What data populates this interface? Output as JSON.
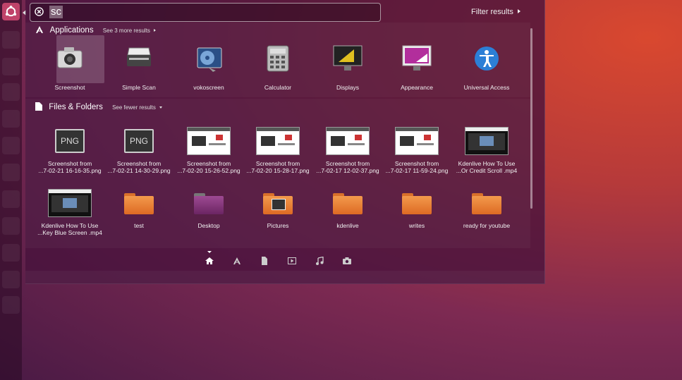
{
  "search": {
    "query": "sc"
  },
  "filter": {
    "label": "Filter results"
  },
  "applications": {
    "title": "Applications",
    "more": "See 3 more results",
    "items": [
      {
        "label": "Screenshot",
        "icon": "camera-icon"
      },
      {
        "label": "Simple Scan",
        "icon": "scanner-icon"
      },
      {
        "label": "vokoscreen",
        "icon": "film-reel-icon"
      },
      {
        "label": "Calculator",
        "icon": "calculator-icon"
      },
      {
        "label": "Displays",
        "icon": "display-icon"
      },
      {
        "label": "Appearance",
        "icon": "appearance-icon"
      },
      {
        "label": "Universal Access",
        "icon": "accessibility-icon"
      }
    ]
  },
  "files": {
    "title": "Files & Folders",
    "fewer": "See fewer results",
    "row1": [
      {
        "line1": "Screenshot from",
        "line2": "...7-02-21 16-16-35.png",
        "type": "png",
        "png_text": "PNG"
      },
      {
        "line1": "Screenshot from",
        "line2": "...7-02-21 14-30-29.png",
        "type": "png",
        "png_text": "PNG"
      },
      {
        "line1": "Screenshot from",
        "line2": "...7-02-20 15-26-52.png",
        "type": "thumb"
      },
      {
        "line1": "Screenshot from",
        "line2": "...7-02-20 15-28-17.png",
        "type": "thumb"
      },
      {
        "line1": "Screenshot from",
        "line2": "...7-02-17 12-02-37.png",
        "type": "thumb"
      },
      {
        "line1": "Screenshot from",
        "line2": "...7-02-17 11-59-24.png",
        "type": "thumb"
      },
      {
        "line1": "Kdenlive How To Use",
        "line2": "...Or Credit Scroll .mp4",
        "type": "video"
      }
    ],
    "row2": [
      {
        "line1": "Kdenlive How To Use",
        "line2": "...Key Blue Screen .mp4",
        "type": "video"
      },
      {
        "line1": "test",
        "line2": "",
        "type": "folder"
      },
      {
        "line1": "Desktop",
        "line2": "",
        "type": "desktop"
      },
      {
        "line1": "Pictures",
        "line2": "",
        "type": "pictures"
      },
      {
        "line1": "kdenlive",
        "line2": "",
        "type": "folder"
      },
      {
        "line1": "writes",
        "line2": "",
        "type": "folder"
      },
      {
        "line1": "ready for youtube",
        "line2": "",
        "type": "folder"
      }
    ]
  },
  "lenses": [
    "home-lens-icon",
    "applications-lens-icon",
    "files-lens-icon",
    "video-lens-icon",
    "music-lens-icon",
    "photo-lens-icon"
  ],
  "colors": {
    "accent": "#c0436a",
    "folder": "#e97a31"
  }
}
